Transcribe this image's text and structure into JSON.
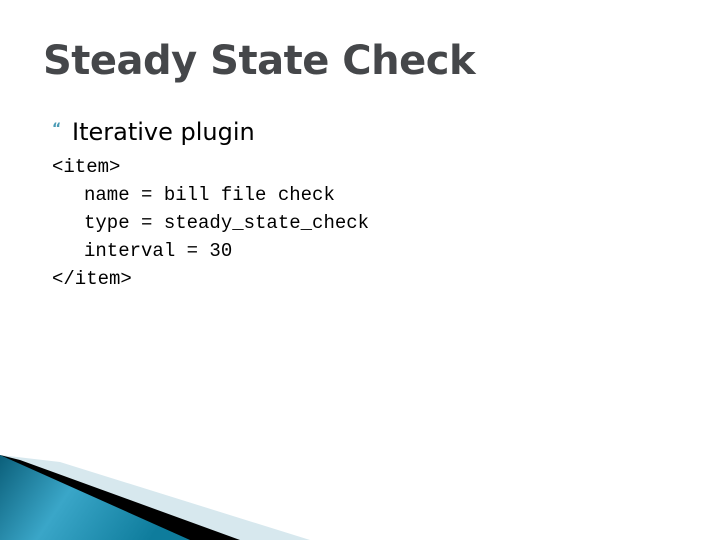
{
  "slide": {
    "title": "Steady State Check",
    "bullet": {
      "icon": "quote-bullet-icon",
      "glyph": "“",
      "text": "Iterative plugin"
    },
    "code_lines": [
      "<item>",
      "name = bill file check",
      "type = steady_state_check",
      "interval = 30",
      "</item>"
    ]
  },
  "colors": {
    "title": "#45474a",
    "accent": "#4a9bb5",
    "wave_dark": "#0d6f8c",
    "wave_light": "#d7e8ee"
  }
}
